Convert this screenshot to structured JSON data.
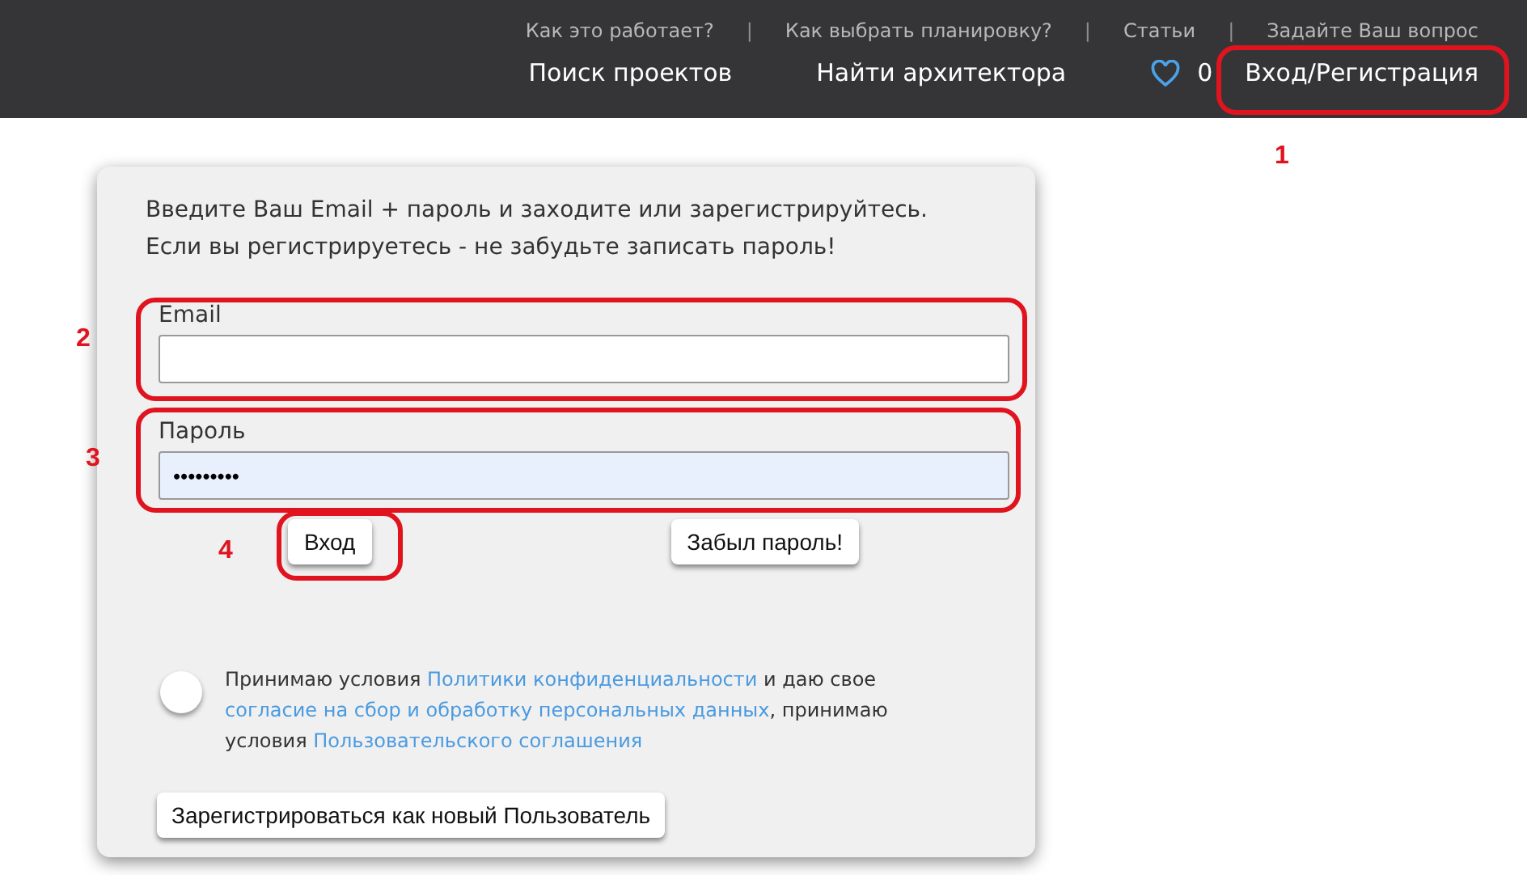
{
  "header": {
    "top_links": [
      {
        "kind": "link",
        "label": "Как это работает?"
      },
      {
        "kind": "separator",
        "label": "|"
      },
      {
        "kind": "link",
        "label": "Как выбрать планировку?"
      },
      {
        "kind": "separator",
        "label": "|"
      },
      {
        "kind": "link",
        "label": "Статьи"
      },
      {
        "kind": "separator",
        "label": "|"
      },
      {
        "kind": "link",
        "label": "Задайте Ваш вопрос"
      }
    ],
    "nav": [
      {
        "label": "Поиск проектов"
      },
      {
        "label": "Найти архитектора"
      }
    ],
    "favorites_count": "0",
    "login": "Вход/Регистрация"
  },
  "login_form": {
    "intro": [
      "Введите Ваш Email + пароль и заходите или зарегистрируйтесь.",
      "Если вы регистрируетесь - не забудьте записать пароль!"
    ],
    "email": {
      "label": "Email"
    },
    "password": {
      "label": "Пароль",
      "value": "•••••••••"
    },
    "login_button": "Вход",
    "forgot_button": "Забыл пароль!",
    "consent": {
      "checked": false,
      "parts": [
        {
          "kind": "text",
          "text": "Принимаю условия "
        },
        {
          "kind": "link",
          "text": "Политики конфиденциальности"
        },
        {
          "kind": "text",
          "text": " и даю свое "
        },
        {
          "kind": "break"
        },
        {
          "kind": "link",
          "text": "согласие на сбор и обработку персональных данных"
        },
        {
          "kind": "text",
          "text": ", принимаю "
        },
        {
          "kind": "break"
        },
        {
          "kind": "text",
          "text": "условия "
        },
        {
          "kind": "link",
          "text": "Пользовательского соглашения"
        }
      ]
    },
    "register_button": "Зарегистрироваться как новый Пользователь"
  },
  "annotations": [
    "1",
    "2",
    "3",
    "4"
  ]
}
